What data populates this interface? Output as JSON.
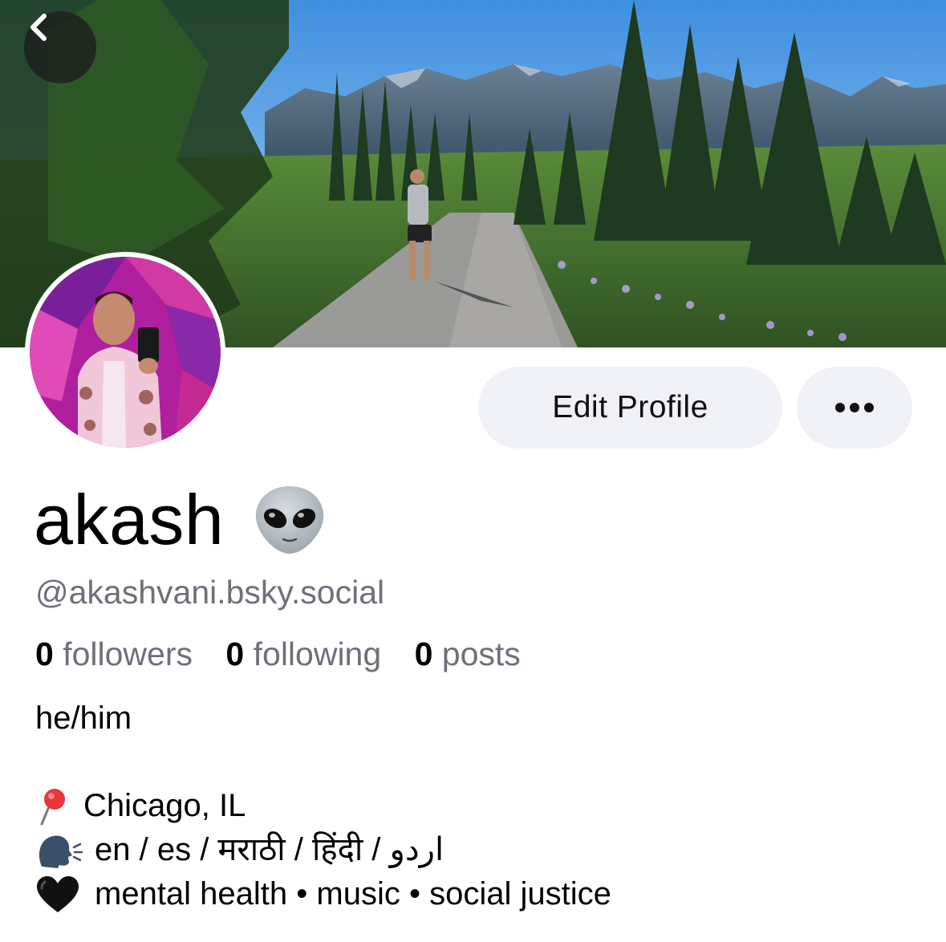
{
  "header": {
    "back_icon": "chevron-left-icon",
    "banner_description_icon": "landscape-banner"
  },
  "actions": {
    "edit_label": "Edit Profile",
    "more_icon": "ellipsis-icon"
  },
  "profile": {
    "display_name": "akash",
    "name_emoji": "alien-emoji",
    "handle": "@akashvani.bsky.social",
    "stats": [
      {
        "count": "0",
        "label": "followers"
      },
      {
        "count": "0",
        "label": "following"
      },
      {
        "count": "0",
        "label": "posts"
      }
    ],
    "bio": {
      "pronouns": "he/him",
      "lines": [
        {
          "icon": "pushpin-icon",
          "text": "Chicago, IL"
        },
        {
          "icon": "speaking-head-icon",
          "text": "en / es / मराठी / हिंदी / اردو"
        },
        {
          "icon": "black-heart-icon",
          "text": "mental health • music • social justice"
        }
      ]
    }
  },
  "colors": {
    "button_bg": "#f0f1f6",
    "muted_text": "#6e6f7b",
    "text": "#000000"
  }
}
